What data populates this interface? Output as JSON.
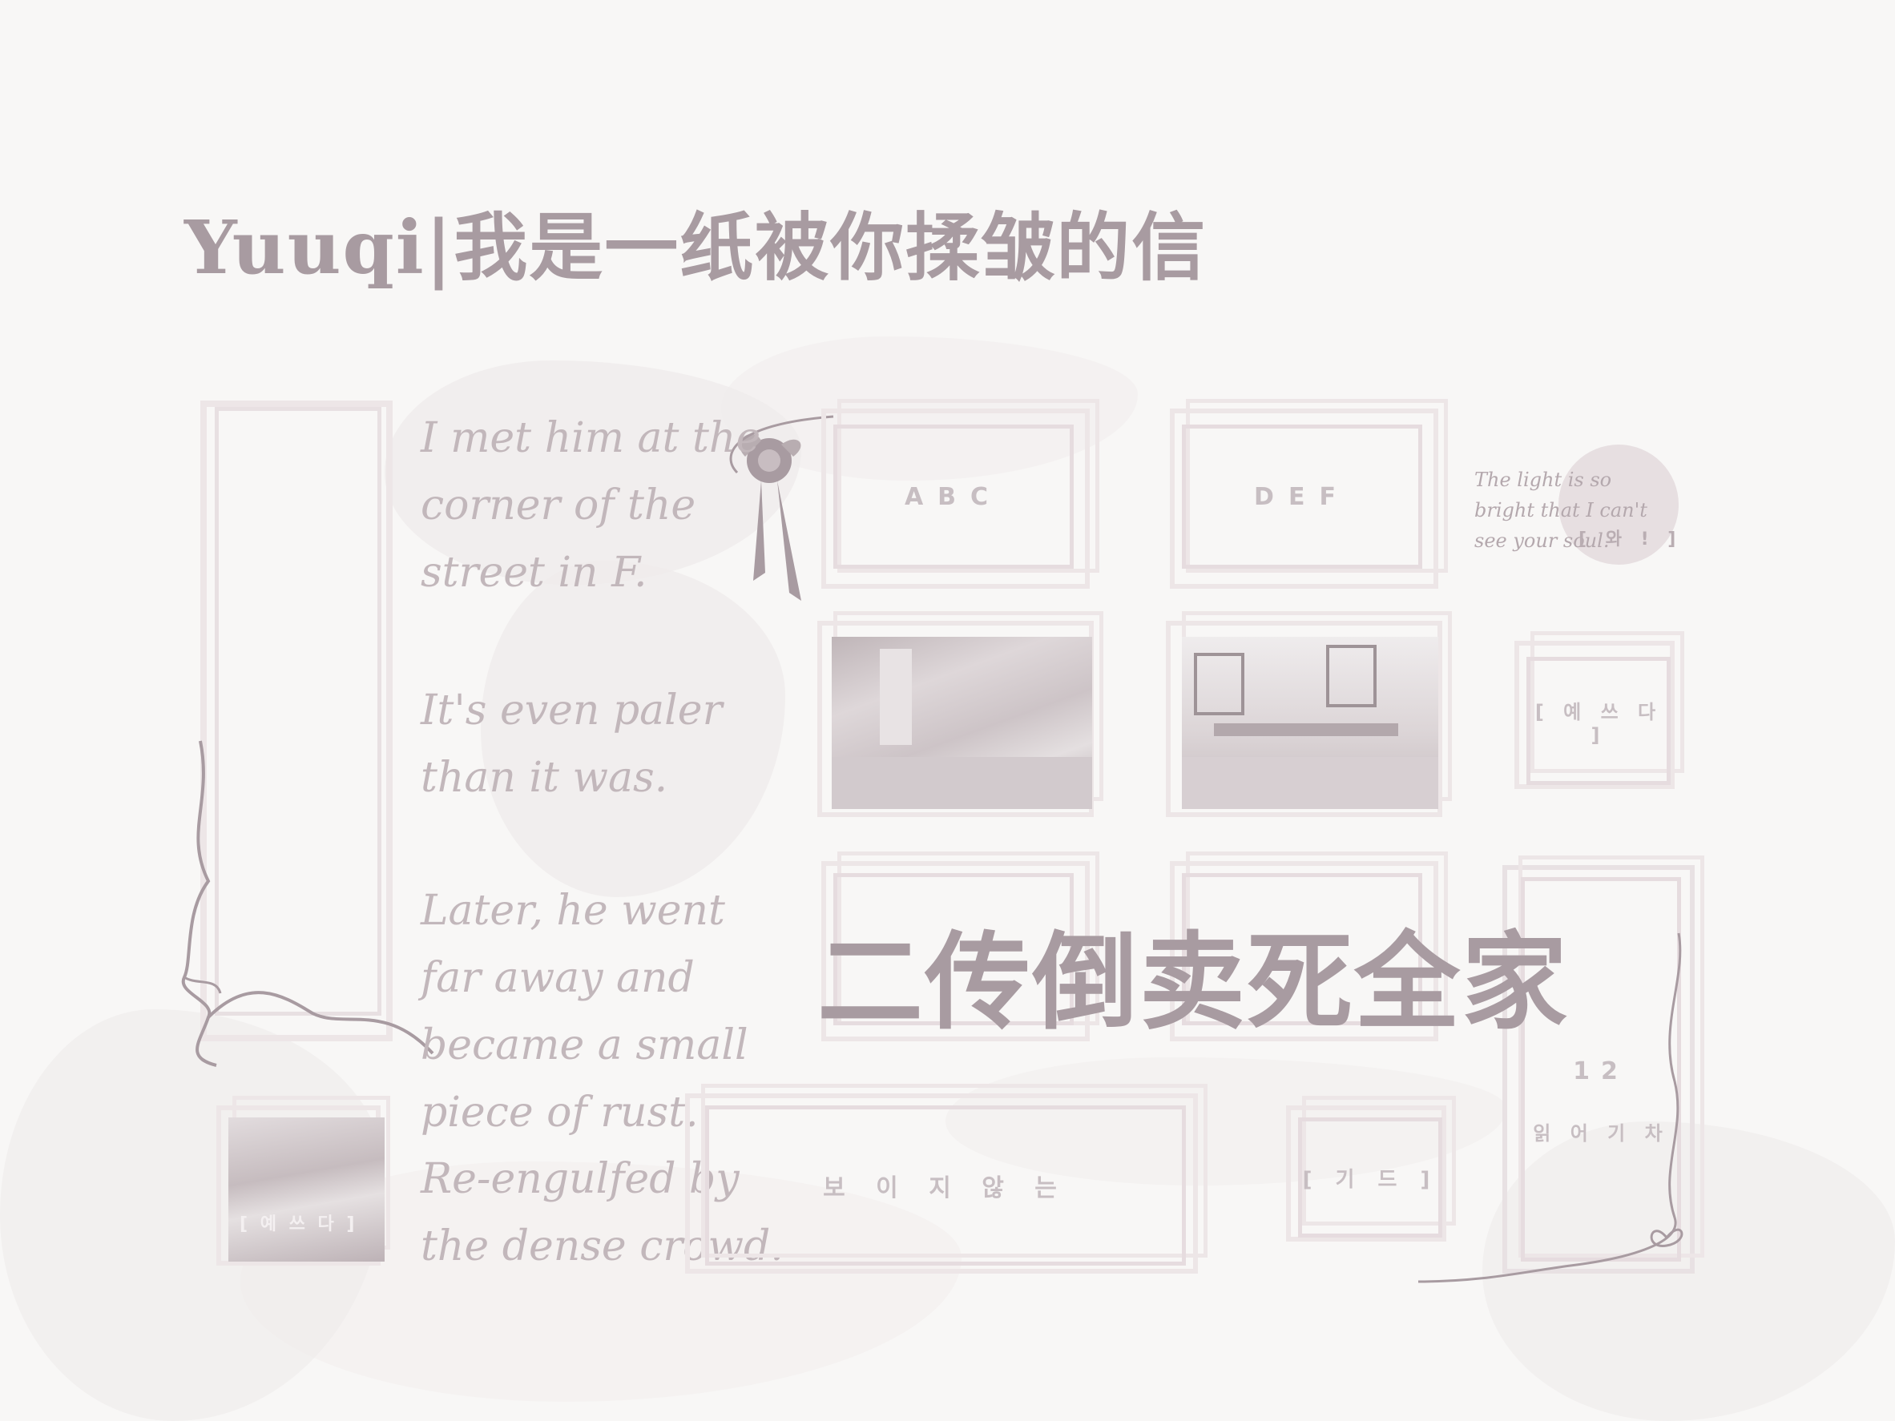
{
  "title": "Yuuqi|我是一纸被你揉皱的信",
  "poem": [
    "I met him at the corner of the street in F.",
    "It's even paler than it was.",
    "Later, he went far away and became a small piece of rust.",
    "Re-engulfed by the dense crowd."
  ],
  "cards": {
    "abc": "ABC",
    "def": "DEF",
    "bracket_small": "[ 와 ! ]",
    "bracket_right": "[ 예 쓰 다 ]",
    "visible": "보 이 지   않 는",
    "bracket_gidu": "[ 기 드 ]",
    "bracket_photo": "[ 예 쓰 다 ]",
    "vertical_num": "12",
    "vertical_text": "읽 어   기 차"
  },
  "side_note": "The light is so bright that I can't see your soul.",
  "overlay_text": "二传倒卖死全家",
  "colors": {
    "background": "#f8f7f6",
    "ink": "#a89ba1",
    "frame": "#ede6e7"
  }
}
